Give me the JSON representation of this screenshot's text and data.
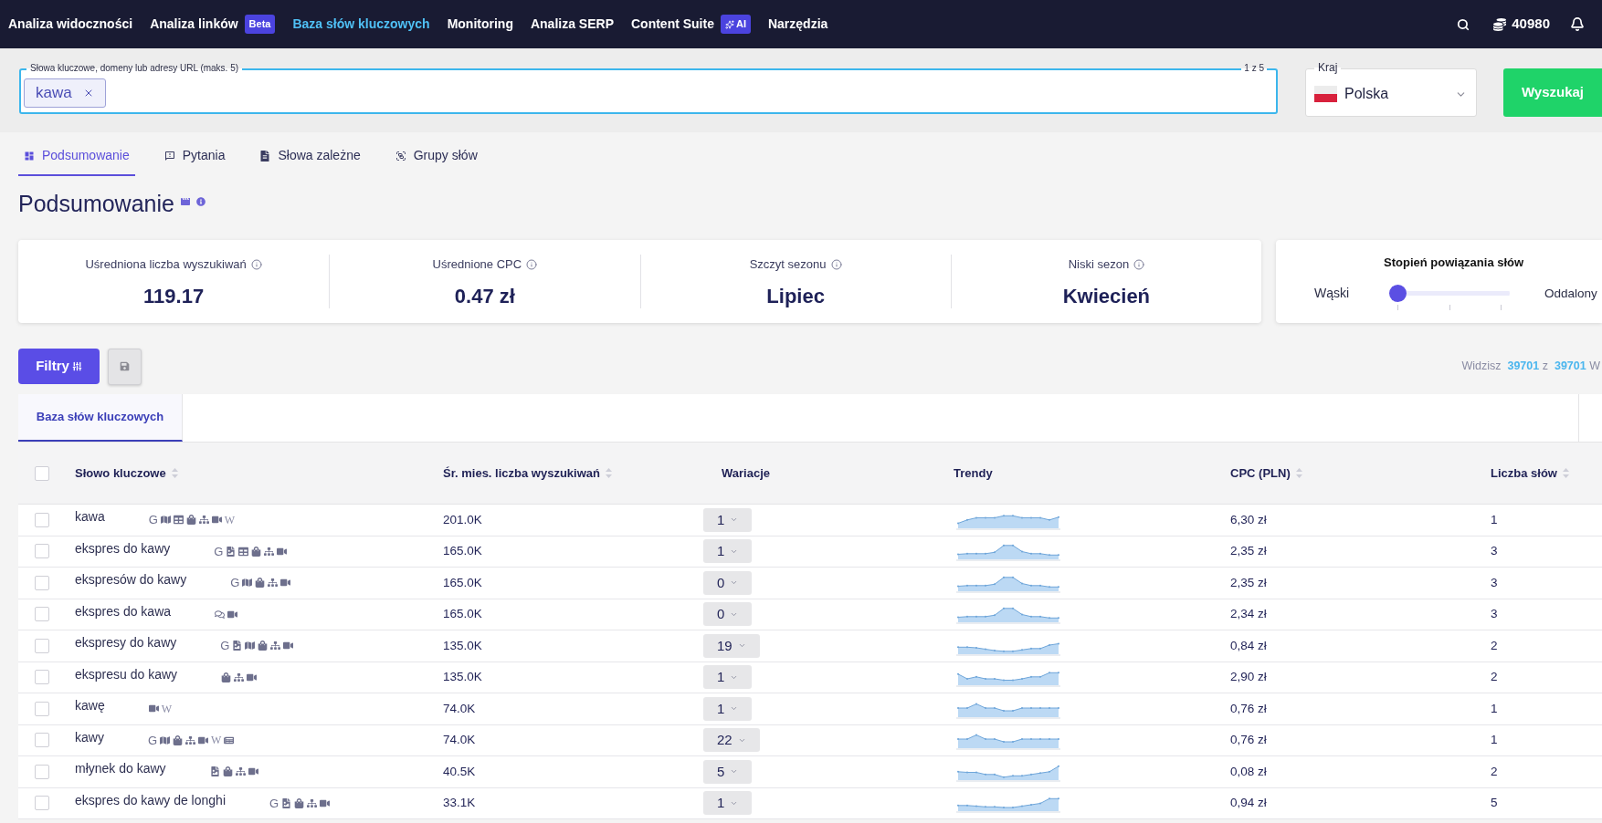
{
  "nav": {
    "items": [
      {
        "label": "Analiza widoczności",
        "selected": false
      },
      {
        "label": "Analiza linków",
        "selected": false,
        "badge": {
          "label": "Beta",
          "sparkle": false
        }
      },
      {
        "label": "Baza słów kluczowych",
        "selected": true
      },
      {
        "label": "Monitoring",
        "selected": false
      },
      {
        "label": "Analiza SERP",
        "selected": false
      },
      {
        "label": "Content Suite",
        "selected": false,
        "badge": {
          "label": "AI",
          "sparkle": true
        }
      },
      {
        "label": "Narzędzia",
        "selected": false
      }
    ],
    "credits": "40980"
  },
  "search": {
    "legend": "Słowa kluczowe, domeny lub adresy URL (maks. 5)",
    "counter": "1 z 5",
    "chips": [
      {
        "label": "kawa"
      }
    ]
  },
  "country": {
    "legend": "Kraj",
    "value": "Polska"
  },
  "search_button": "Wyszukaj",
  "tabs": [
    {
      "label": "Podsumowanie",
      "kind": "summary",
      "selected": true
    },
    {
      "label": "Pytania",
      "kind": "questions",
      "selected": false
    },
    {
      "label": "Słowa zależne",
      "kind": "related",
      "selected": false
    },
    {
      "label": "Grupy słów",
      "kind": "groups",
      "selected": false
    }
  ],
  "summary": {
    "title": "Podsumowanie",
    "stats": [
      {
        "label": "Uśredniona liczba wyszukiwań",
        "value": "119.17"
      },
      {
        "label": "Uśrednione CPC",
        "value": "0.47 zł"
      },
      {
        "label": "Szczyt sezonu",
        "value": "Lipiec"
      },
      {
        "label": "Niski sezon",
        "value": "Kwiecień"
      }
    ]
  },
  "relatedness": {
    "title": "Stopień powiązania słów",
    "min_label": "Wąski",
    "max_label": "Oddalony",
    "level": 0
  },
  "toolbar": {
    "filter_button": "Filtry",
    "count": {
      "label": "Widzisz",
      "shown": "39701",
      "of": "z",
      "total": "39701",
      "trailing": "W"
    }
  },
  "table": {
    "tabs": [
      {
        "label": "Baza słów kluczowych",
        "selected": true
      }
    ],
    "select_all": {
      "checked": false
    },
    "columns": [
      {
        "label": "Słowo kluczowe",
        "sortable": true
      },
      {
        "label": "Śr. mies. liczba wyszukiwań",
        "sortable": true
      },
      {
        "label": "Wariacje",
        "sortable": false
      },
      {
        "label": "Trendy",
        "sortable": false
      },
      {
        "label": "CPC (PLN)",
        "sortable": true
      },
      {
        "label": "Liczba słów",
        "sortable": true
      }
    ],
    "rows": [
      {
        "checked": false,
        "keyword": "kawa",
        "features": [
          {
            "kind": "letter",
            "text": "G"
          },
          {
            "kind": "map"
          },
          {
            "kind": "table"
          },
          {
            "kind": "bag"
          },
          {
            "kind": "sitemap"
          },
          {
            "kind": "video"
          },
          {
            "kind": "serif_letter",
            "text": "W"
          }
        ],
        "volume": "201.0K",
        "variations": "1",
        "cpc": "6,30 zł",
        "words": "1"
      },
      {
        "checked": false,
        "keyword": "ekspres do kawy",
        "features": [
          {
            "kind": "letter",
            "text": "G"
          },
          {
            "kind": "image"
          },
          {
            "kind": "table"
          },
          {
            "kind": "bag"
          },
          {
            "kind": "sitemap"
          },
          {
            "kind": "video"
          }
        ],
        "volume": "165.0K",
        "variations": "1",
        "cpc": "2,35 zł",
        "words": "3"
      },
      {
        "checked": false,
        "keyword": "ekspresów do kawy",
        "features": [
          {
            "kind": "letter",
            "text": "G"
          },
          {
            "kind": "map"
          },
          {
            "kind": "bag"
          },
          {
            "kind": "sitemap"
          },
          {
            "kind": "video"
          }
        ],
        "volume": "165.0K",
        "variations": "0",
        "cpc": "2,35 zł",
        "words": "3"
      },
      {
        "checked": false,
        "keyword": "ekspres do kawa",
        "features": [
          {
            "kind": "comments"
          },
          {
            "kind": "video"
          }
        ],
        "volume": "165.0K",
        "variations": "0",
        "cpc": "2,34 zł",
        "words": "3"
      },
      {
        "checked": false,
        "keyword": "ekspresy do kawy",
        "features": [
          {
            "kind": "letter",
            "text": "G"
          },
          {
            "kind": "image"
          },
          {
            "kind": "map"
          },
          {
            "kind": "bag"
          },
          {
            "kind": "sitemap"
          },
          {
            "kind": "video"
          }
        ],
        "volume": "135.0K",
        "variations": "19",
        "cpc": "0,84 zł",
        "words": "2"
      },
      {
        "checked": false,
        "keyword": "ekspresu do kawy",
        "features": [
          {
            "kind": "bag"
          },
          {
            "kind": "sitemap"
          },
          {
            "kind": "video"
          }
        ],
        "volume": "135.0K",
        "variations": "1",
        "cpc": "2,90 zł",
        "words": "2"
      },
      {
        "checked": false,
        "keyword": "kawę",
        "features": [
          {
            "kind": "video"
          },
          {
            "kind": "serif_letter",
            "text": "W"
          }
        ],
        "volume": "74.0K",
        "variations": "1",
        "cpc": "0,76 zł",
        "words": "1"
      },
      {
        "checked": false,
        "keyword": "kawy",
        "features": [
          {
            "kind": "letter",
            "text": "G"
          },
          {
            "kind": "map"
          },
          {
            "kind": "bag"
          },
          {
            "kind": "sitemap"
          },
          {
            "kind": "video"
          },
          {
            "kind": "serif_letter",
            "text": "W"
          },
          {
            "kind": "news"
          }
        ],
        "volume": "74.0K",
        "variations": "22",
        "cpc": "0,76 zł",
        "words": "1"
      },
      {
        "checked": false,
        "keyword": "młynek do kawy",
        "features": [
          {
            "kind": "image"
          },
          {
            "kind": "bag"
          },
          {
            "kind": "sitemap"
          },
          {
            "kind": "video"
          }
        ],
        "volume": "40.5K",
        "variations": "5",
        "cpc": "0,08 zł",
        "words": "2"
      },
      {
        "checked": false,
        "keyword": "ekspres do kawy de longhi",
        "features": [
          {
            "kind": "letter",
            "text": "G"
          },
          {
            "kind": "image"
          },
          {
            "kind": "bag"
          },
          {
            "kind": "sitemap"
          },
          {
            "kind": "video"
          }
        ],
        "volume": "33.1K",
        "variations": "1",
        "cpc": "0,94 zł",
        "words": "5"
      }
    ]
  }
}
